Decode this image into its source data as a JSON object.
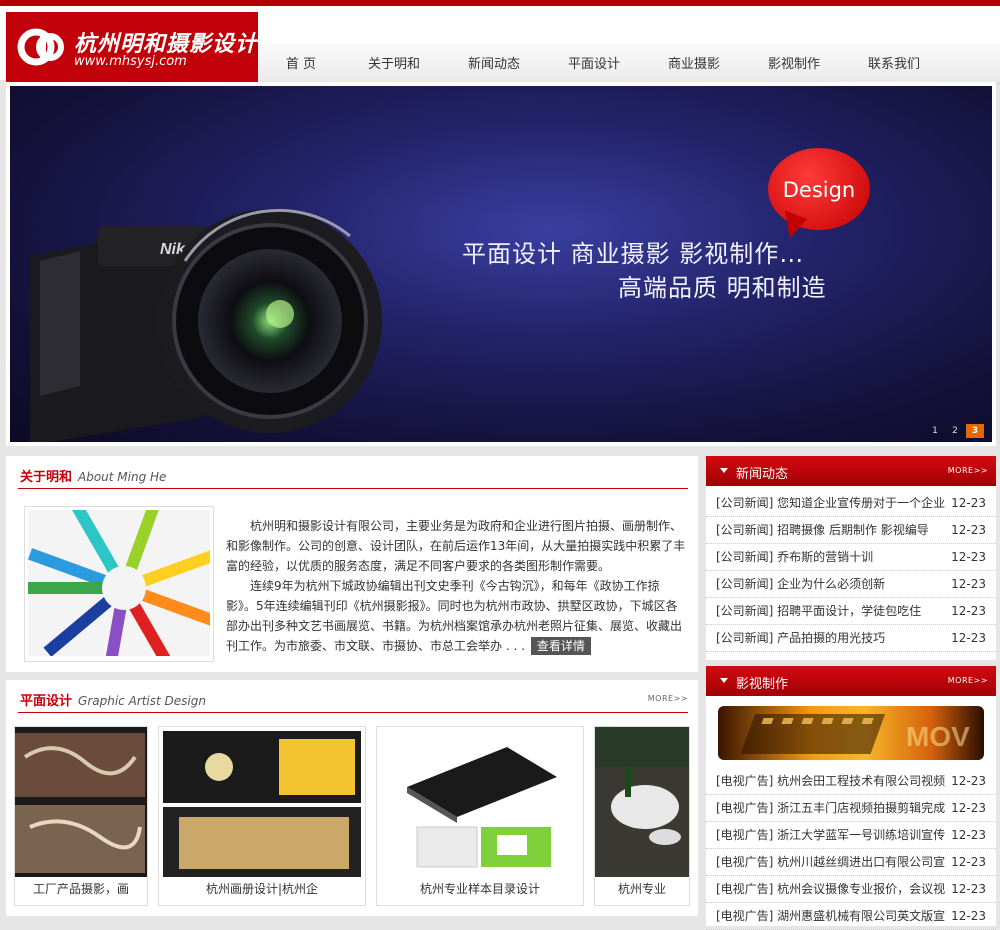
{
  "logo": {
    "title": "杭州明和摄影设计",
    "url": "www.mhsysj.com"
  },
  "nav": [
    "首 页",
    "关于明和",
    "新闻动态",
    "平面设计",
    "商业摄影",
    "影视制作",
    "联系我们"
  ],
  "banner": {
    "bubble": "Design",
    "line1": "平面设计 商业摄影 影视制作…",
    "line2": "高端品质 明和制造",
    "dots": [
      "1",
      "2",
      "3"
    ]
  },
  "about": {
    "title": "关于明和",
    "title_en": "About Ming He",
    "p1": "杭州明和摄影设计有限公司，主要业务是为政府和企业进行图片拍摄、画册制作、和影像制作。公司的创意、设计团队，在前后运作13年间，从大量拍摄实践中积累了丰富的经验，以优质的服务态度，满足不同客户要求的各类图形制作需要。",
    "p2": "连续9年为杭州下城政协编辑出刊文史季刊《今古钩沉》，和每年《政协工作掠影》。5年连续编辑刊印《杭州摄影报》。同时也为杭州市政协、拱墅区政协，下城区各部办出刊多种文艺书画展览、书籍。为杭州档案馆承办杭州老照片征集、展览、收藏出刊工作。为市旅委、市文联、市摄协、市总工会举办 . . .",
    "more": "查看详情"
  },
  "news": {
    "title": "新闻动态",
    "more": "MORE>>",
    "items": [
      {
        "title": "[公司新闻] 您知道企业宣传册对于一个企业",
        "date": "12-23"
      },
      {
        "title": "[公司新闻] 招聘摄像 后期制作 影视编导",
        "date": "12-23"
      },
      {
        "title": "[公司新闻] 乔布斯的营销十训",
        "date": "12-23"
      },
      {
        "title": "[公司新闻] 企业为什么必须创新",
        "date": "12-23"
      },
      {
        "title": "[公司新闻] 招聘平面设计，学徒包吃住",
        "date": "12-23"
      },
      {
        "title": "[公司新闻] 产品拍摄的用光技巧",
        "date": "12-23"
      }
    ]
  },
  "design": {
    "title": "平面设计",
    "title_en": "Graphic Artist Design",
    "more": "MORE>>",
    "items": [
      "工厂产品摄影，画",
      "杭州画册设计|杭州企",
      "杭州专业样本目录设计",
      "杭州专业"
    ]
  },
  "video": {
    "title": "影视制作",
    "more": "MORE>>",
    "items": [
      {
        "title": "[电视广告] 杭州会田工程技术有限公司视频",
        "date": "12-23"
      },
      {
        "title": "[电视广告] 浙江五丰门店视频拍摄剪辑完成",
        "date": "12-23"
      },
      {
        "title": "[电视广告] 浙江大学蓝军一号训练培训宣传",
        "date": "12-23"
      },
      {
        "title": "[电视广告] 杭州川越丝绸进出口有限公司宣",
        "date": "12-23"
      },
      {
        "title": "[电视广告] 杭州会议摄像专业报价，会议视",
        "date": "12-23"
      },
      {
        "title": "[电视广告] 湖州惠盛机械有限公司英文版宣",
        "date": "12-23"
      }
    ]
  }
}
